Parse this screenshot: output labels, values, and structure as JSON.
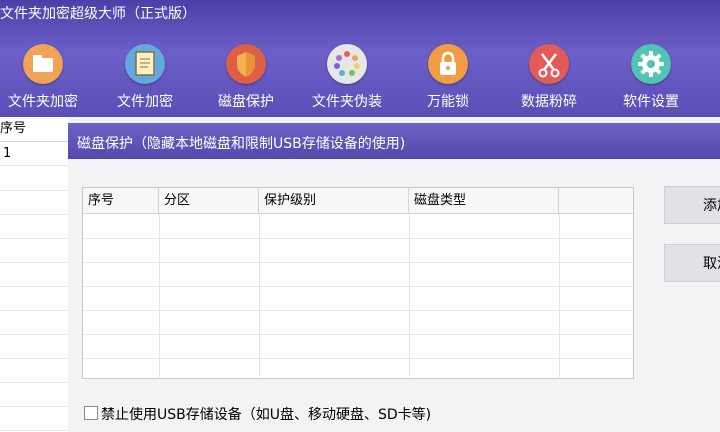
{
  "app": {
    "title": "文件夹加密超级大师（正式版）"
  },
  "toolbar": {
    "items": [
      {
        "label": "文件夹加密",
        "icon": "folder-icon"
      },
      {
        "label": "文件加密",
        "icon": "document-icon"
      },
      {
        "label": "磁盘保护",
        "icon": "shield-icon"
      },
      {
        "label": "文件夹伪装",
        "icon": "palette-icon"
      },
      {
        "label": "万能锁",
        "icon": "lock-icon"
      },
      {
        "label": "数据粉碎",
        "icon": "scissors-icon"
      },
      {
        "label": "软件设置",
        "icon": "gear-icon"
      }
    ],
    "icon_colors": [
      "#f0a354",
      "#f2c767",
      "#e06a3a",
      "#dcdcdc",
      "#f29b45",
      "#e35a5a",
      "#53c4b3"
    ]
  },
  "left_list": {
    "header": "序号",
    "rows": [
      "1"
    ]
  },
  "dialog": {
    "title": "磁盘保护（隐藏本地磁盘和限制USB存储设备的使用)",
    "table": {
      "columns": [
        "序号",
        "分区",
        "保护级别",
        "磁盘类型"
      ]
    },
    "buttons": {
      "add": "添加",
      "cancel": "取消"
    },
    "usb_option": {
      "label": "禁止使用USB存储设备（如U盘、移动硬盘、SD卡等)",
      "checked": false
    }
  }
}
